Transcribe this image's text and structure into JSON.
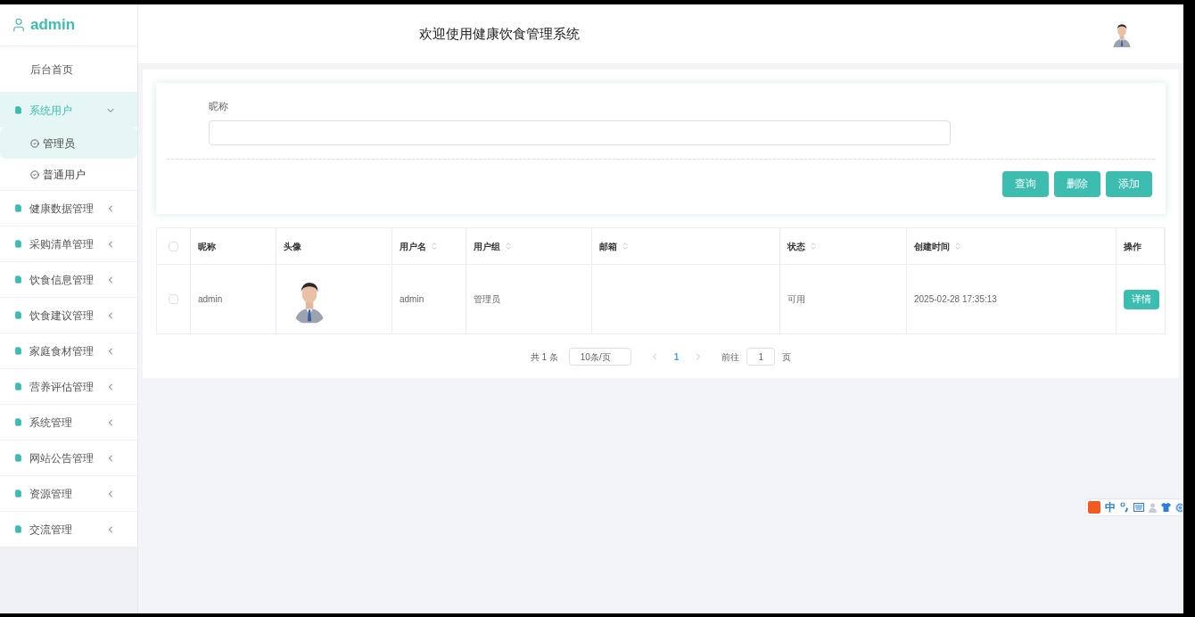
{
  "sidebar": {
    "user": "admin",
    "items": [
      {
        "label": "后台首页",
        "kind": "link",
        "selected": false
      },
      {
        "label": "系统用户",
        "kind": "group",
        "expanded": true,
        "selected": true,
        "children": [
          {
            "label": "管理员",
            "selected": true
          },
          {
            "label": "普通用户",
            "selected": false
          }
        ]
      },
      {
        "label": "健康数据管理",
        "kind": "group",
        "expanded": false,
        "selected": false
      },
      {
        "label": "采购清单管理",
        "kind": "group",
        "expanded": false,
        "selected": false
      },
      {
        "label": "饮食信息管理",
        "kind": "group",
        "expanded": false,
        "selected": false
      },
      {
        "label": "饮食建议管理",
        "kind": "group",
        "expanded": false,
        "selected": false
      },
      {
        "label": "家庭食材管理",
        "kind": "group",
        "expanded": false,
        "selected": false
      },
      {
        "label": "营养评估管理",
        "kind": "group",
        "expanded": false,
        "selected": false
      },
      {
        "label": "系统管理",
        "kind": "group",
        "expanded": false,
        "selected": false
      },
      {
        "label": "网站公告管理",
        "kind": "group",
        "expanded": false,
        "selected": false
      },
      {
        "label": "资源管理",
        "kind": "group",
        "expanded": false,
        "selected": false
      },
      {
        "label": "交流管理",
        "kind": "group",
        "expanded": false,
        "selected": false
      }
    ]
  },
  "header": {
    "title": "欢迎使用健康饮食管理系统"
  },
  "search": {
    "label": "昵称",
    "buttons": [
      "查询",
      "删除",
      "添加"
    ]
  },
  "table": {
    "select_all": {
      "checked": false
    },
    "columns": [
      {
        "label": "昵称",
        "sortable": false
      },
      {
        "label": "头像",
        "sortable": false
      },
      {
        "label": "用户名",
        "sortable": true
      },
      {
        "label": "用户组",
        "sortable": true
      },
      {
        "label": "邮箱",
        "sortable": true
      },
      {
        "label": "状态",
        "sortable": true
      },
      {
        "label": "创建时间",
        "sortable": true
      },
      {
        "label": "操作",
        "sortable": false
      }
    ],
    "rows": [
      {
        "checked": false,
        "nickname": "admin",
        "username": "admin",
        "group": "管理员",
        "status": "可用",
        "created": "2025-02-28 17:35:13",
        "action": "详情"
      }
    ]
  },
  "pagination": {
    "total": "共 1 条",
    "page_size": "10条/页",
    "pages": [
      {
        "label": "1",
        "selected": true
      }
    ],
    "goto_label": "前往",
    "goto_value": "1",
    "goto_suffix": "页"
  },
  "ime_toolbar": {
    "mode": "中"
  }
}
